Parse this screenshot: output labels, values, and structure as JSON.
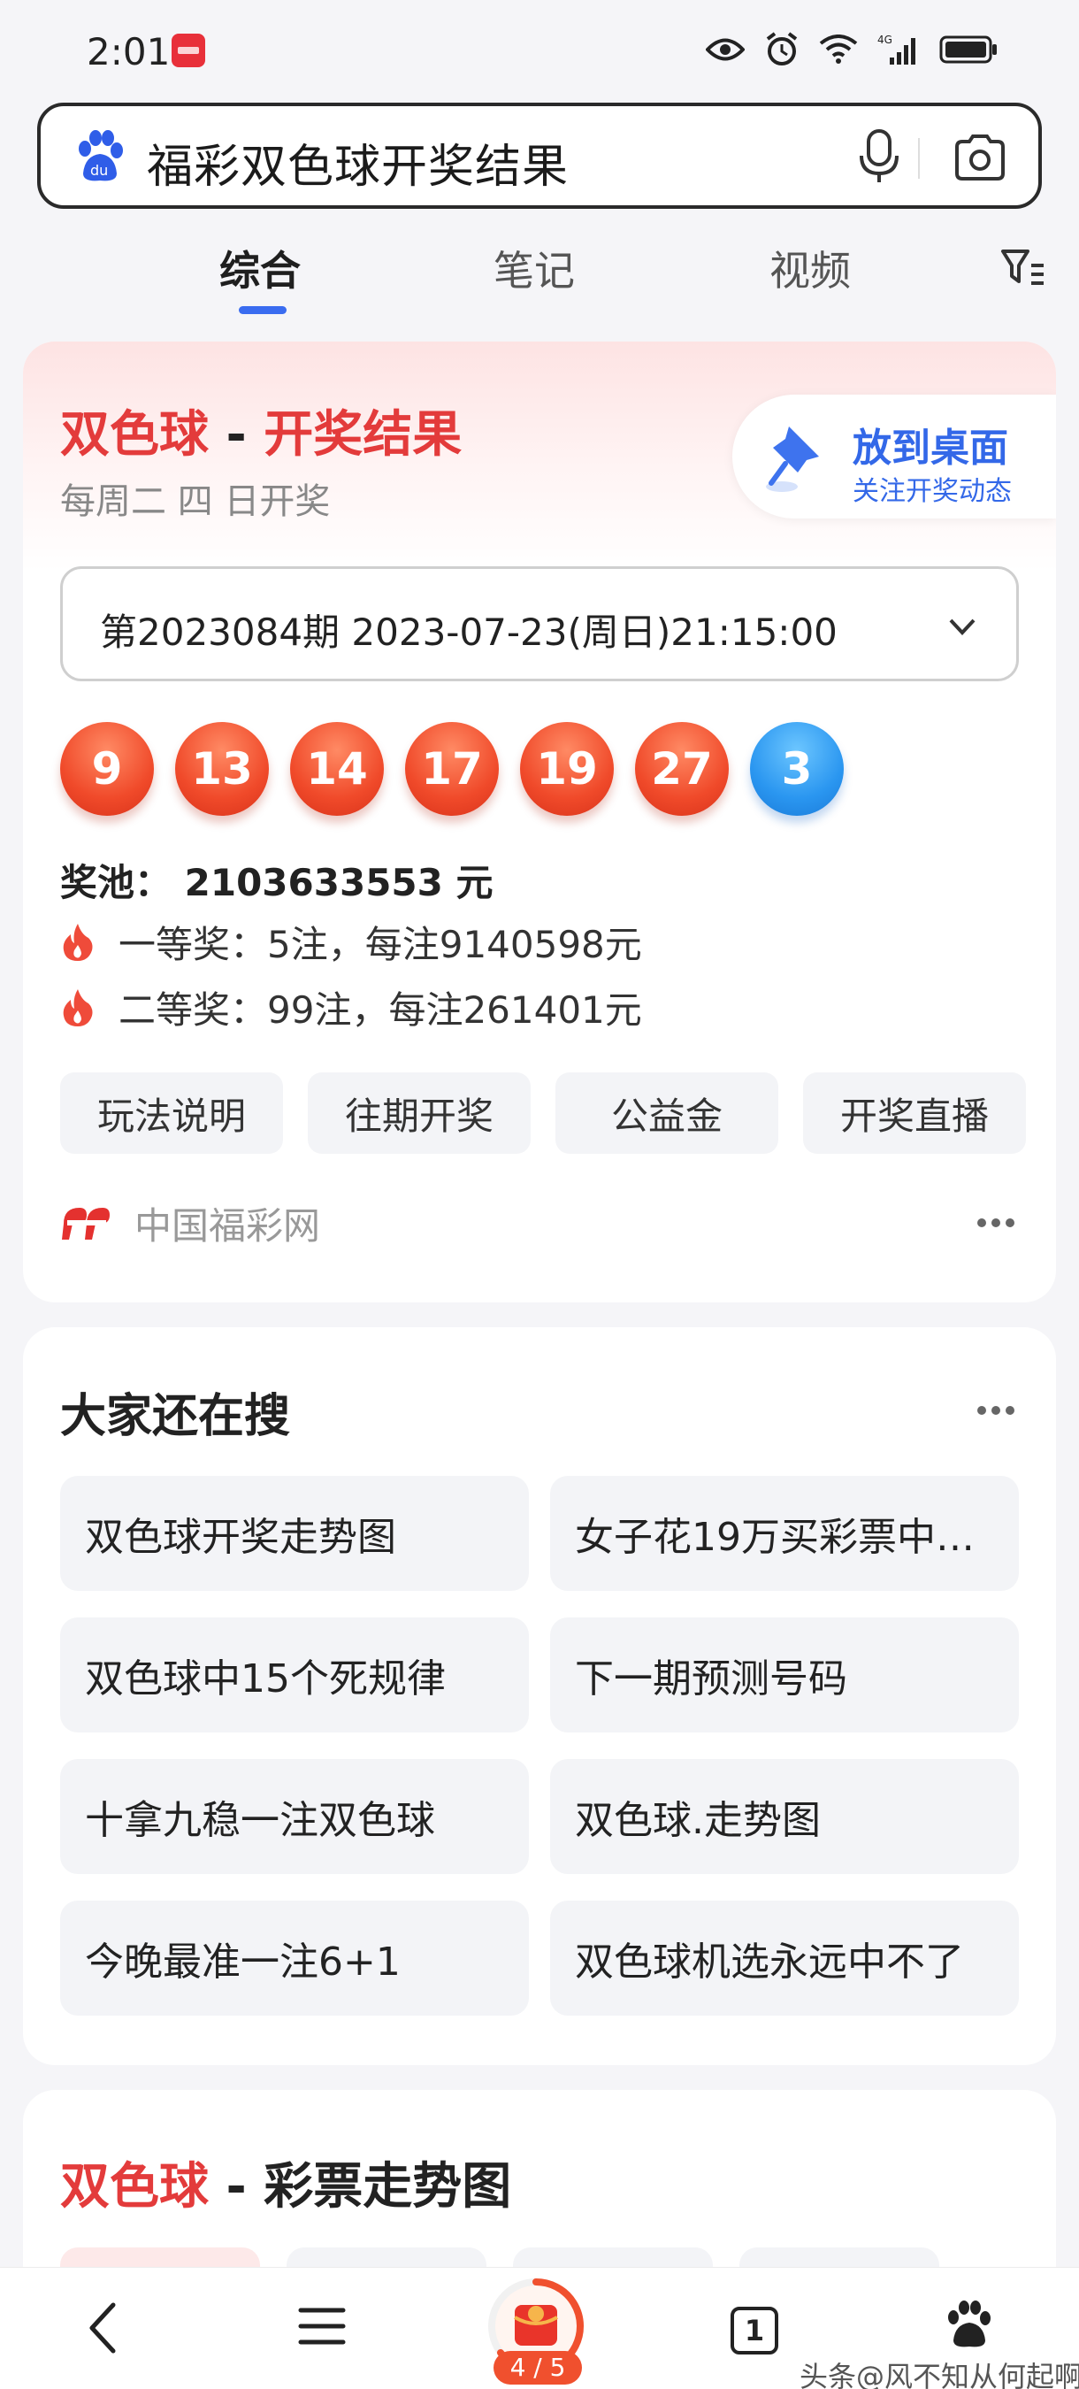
{
  "status_bar": {
    "time": "2:01",
    "network": "4G"
  },
  "search": {
    "query": "福彩双色球开奖结果"
  },
  "tabs": [
    {
      "label": "综合",
      "active": true
    },
    {
      "label": "笔记",
      "active": false
    },
    {
      "label": "视频",
      "active": false
    }
  ],
  "lottery_card": {
    "title_name": "双色球",
    "title_sep": " - ",
    "title_suffix": "开奖结果",
    "schedule": "每周二 四 日开奖",
    "desktop_button": {
      "label": "放到桌面",
      "sublabel": "关注开奖动态"
    },
    "period_select": "第2023084期 2023-07-23(周日)21:15:00",
    "red_balls": [
      "9",
      "13",
      "14",
      "17",
      "19",
      "27"
    ],
    "blue_ball": "3",
    "pool": "奖池：  2103633553 元",
    "prizes": [
      "一等奖：5注，每注9140598元",
      "二等奖：99注，每注261401元"
    ],
    "quick_links": [
      "玩法说明",
      "往期开奖",
      "公益金",
      "开奖直播"
    ],
    "source": "中国福彩网"
  },
  "related_searches": {
    "title": "大家还在搜",
    "items": [
      "双色球开奖走势图",
      "女子花19万买彩票中…",
      "双色球中15个死规律",
      "下一期预测号码",
      "十拿九稳一注双色球",
      "双色球.走势图",
      "今晚最准一注6+1",
      "双色球机选永远中不了"
    ]
  },
  "trend_card": {
    "title_name": "双色球",
    "title_sep": " - ",
    "title_suffix": "彩票走势图"
  },
  "bottom_nav": {
    "reward_progress": "4 / 5",
    "tab_count": "1",
    "watermark": "头条@风不知从何起啊"
  },
  "colors": {
    "accent_blue": "#3a6cf0",
    "lottery_red": "#e33b3b",
    "blue_ball": "#2a96f0"
  }
}
